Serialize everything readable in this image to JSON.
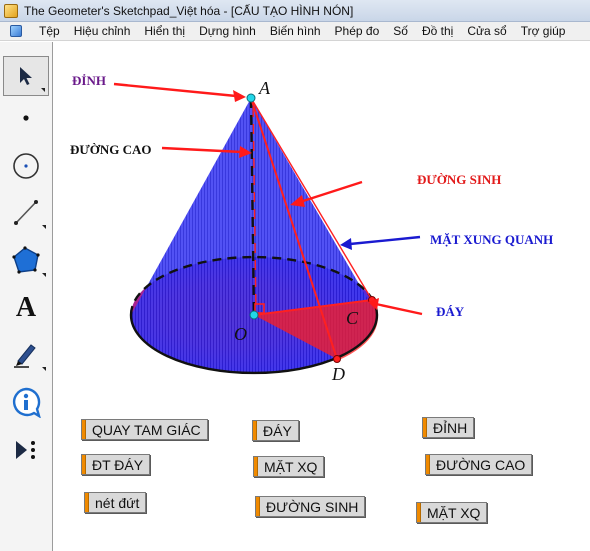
{
  "window": {
    "title": "The Geometer's Sketchpad_Việt hóa - [CẤU TẠO HÌNH NÓN]"
  },
  "menu": [
    "Tệp",
    "Hiệu chỉnh",
    "Hiển thị",
    "Dựng hình",
    "Biến hình",
    "Phép đo",
    "Số",
    "Đồ thị",
    "Cửa sổ",
    "Trợ giúp"
  ],
  "toolbox": [
    {
      "name": "arrow-select-icon",
      "active": true
    },
    {
      "name": "point-tool-icon"
    },
    {
      "name": "compass-tool-icon"
    },
    {
      "name": "straightedge-tool-icon"
    },
    {
      "name": "polygon-tool-icon"
    },
    {
      "name": "text-tool-icon",
      "glyph": "A"
    },
    {
      "name": "marker-tool-icon"
    },
    {
      "name": "information-tool-icon"
    },
    {
      "name": "custom-tool-icon"
    }
  ],
  "figure": {
    "points": {
      "A": "A",
      "O": "O",
      "C": "C",
      "D": "D"
    },
    "annotations": {
      "apex": "ĐỈNH",
      "height": "ĐƯỜNG CAO",
      "generatrix": "ĐƯỜNG SINH",
      "lateral_surface": "MẶT XUNG QUANH",
      "base": "ĐÁY"
    },
    "colors": {
      "cone_blue": "#2222ee",
      "base_red": "#ff1a1a",
      "apex_label": "#6a1a8a",
      "height_label": "#111111",
      "generatrix_label": "#e21b1b",
      "lateral_label": "#1a1ad0",
      "base_label": "#1a1ad0",
      "point_cyan": "#22d6e8"
    }
  },
  "buttons": {
    "quay_tam_giac": "QUAY TAM GIÁC",
    "day": "ĐÁY",
    "dinh": "ĐỈNH",
    "dt_day": "ĐT ĐÁY",
    "mat_xq_1": "MẶT XQ",
    "duong_cao": "ĐƯỜNG CAO",
    "net_dut": "nét đứt",
    "duong_sinh": "ĐƯỜNG SINH",
    "mat_xq_2": "MẶT XQ"
  }
}
